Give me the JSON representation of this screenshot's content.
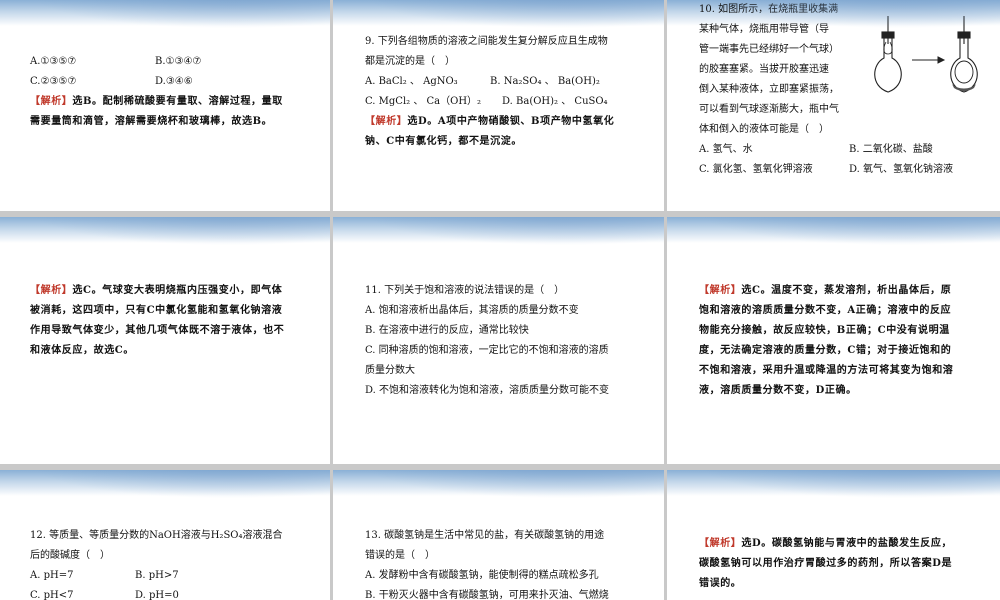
{
  "s1": {
    "opt_a": "A.①③⑤⑦",
    "opt_b": "B.①③④⑦",
    "opt_c": "C.②③⑤⑦",
    "opt_d": "D.③④⑥",
    "tag": "【解析】",
    "analysis_1": "选B。配制稀硫酸要有量取、溶解过程，量取",
    "analysis_2": "需要量筒和滴管，溶解需要烧杯和玻璃棒，故选B。"
  },
  "s2": {
    "q_line1": "9. 下列各组物质的溶液之间能发生复分解反应且生成物",
    "q_line2": "都是沉淀的是（　）",
    "opt_a": "A. BaCl₂ 、 AgNO₃",
    "opt_b": "B. Na₂SO₄ 、 Ba(OH)₂",
    "opt_c": "C. MgCl₂ 、 Ca（OH）₂",
    "opt_d": "D. Ba(OH)₂ 、 CuSO₄",
    "tag": "【解析】",
    "analysis_1": "选D。A项中产物硝酸钡、B项产物中氢氧化",
    "analysis_2": "钠、C中有氯化钙，都不是沉淀。"
  },
  "s3": {
    "line1": "10. 如图所示，在烧瓶里收集满",
    "line2": "某种气体，烧瓶用带导管（导",
    "line3": "管一端事先已经绑好一个气球）",
    "line4": "的胶塞塞紧。当拔开胶塞迅速",
    "line5": "倒入某种液体，立即塞紧振荡，",
    "line6": "可以看到气球逐渐膨大，瓶中气",
    "line7": "体和倒入的液体可能是（　）",
    "opt_a": "A. 氢气、水",
    "opt_b": "B. 二氧化碳、盐酸",
    "opt_c": "C. 氯化氢、氢氧化钾溶液",
    "opt_d": "D. 氧气、氢氧化钠溶液"
  },
  "s4": {
    "tag": "【解析】",
    "analysis_1": "选C。气球变大表明烧瓶内压强变小，即气体",
    "analysis_2": "被消耗，这四项中，只有C中氯化氢能和氢氧化钠溶液",
    "analysis_3": "作用导致气体变少，其他几项气体既不溶于液体，也不",
    "analysis_4": "和液体反应，故选C。"
  },
  "s5": {
    "q_line1": "11. 下列关于饱和溶液的说法错误的是（　）",
    "opt_a": "A. 饱和溶液析出晶体后，其溶质的质量分数不变",
    "opt_b": "B. 在溶液中进行的反应，通常比较快",
    "opt_c1": "C. 同种溶质的饱和溶液，一定比它的不饱和溶液的溶质",
    "opt_c2": "质量分数大",
    "opt_d": "D. 不饱和溶液转化为饱和溶液，溶质质量分数可能不变"
  },
  "s6": {
    "tag": "【解析】",
    "analysis_1": "选C。温度不变，蒸发溶剂，析出晶体后，原",
    "analysis_2": "饱和溶液的溶质质量分数不变，A正确；溶液中的反应",
    "analysis_3": "物能充分接触，故反应较快，B正确；C中没有说明温",
    "analysis_4": "度，无法确定溶液的质量分数，C错；对于接近饱和的",
    "analysis_5": "不饱和溶液，采用升温或降温的方法可将其变为饱和溶",
    "analysis_6": "液，溶质质量分数不变，D正确。"
  },
  "s7": {
    "q_line1": "12. 等质量、等质量分数的NaOH溶液与H₂SO₄溶液混合",
    "q_line2": "后的酸碱度（　）",
    "opt_a": "A. pH=7",
    "opt_b": "B. pH>7",
    "opt_c": "C. pH<7",
    "opt_d": "D. pH=0"
  },
  "s8": {
    "q_line1": "13. 碳酸氢钠是生活中常见的盐，有关碳酸氢钠的用途",
    "q_line2": "错误的是（　）",
    "opt_a": "A. 发酵粉中含有碳酸氢钠，能使制得的糕点疏松多孔",
    "opt_b": "B. 干粉灭火器中含有碳酸氢钠，可用来扑灭油、气燃烧"
  },
  "s9": {
    "tag": "【解析】",
    "analysis_1": "选D。碳酸氢钠能与胃液中的盐酸发生反应，",
    "analysis_2": "碳酸氢钠可以用作治疗胃酸过多的药剂，所以答案D是",
    "analysis_3": "错误的。"
  }
}
